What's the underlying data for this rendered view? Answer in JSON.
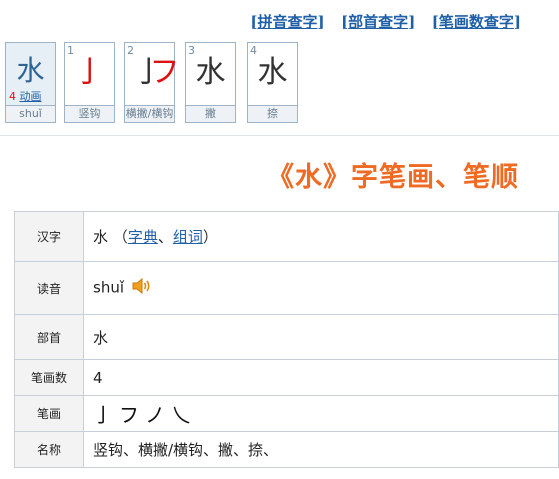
{
  "nav": {
    "bracket_open": "[",
    "bracket_close": "]",
    "links": [
      "拼音查字",
      "部首查字",
      "笔画数查字"
    ]
  },
  "cards": {
    "first": {
      "glyph": "水",
      "strokes": "4",
      "animate_label": "动画",
      "pinyin": "shuǐ"
    },
    "steps": [
      {
        "num": "1",
        "glyph_red": "亅",
        "glyph_black": "",
        "caption": "竖钩"
      },
      {
        "num": "2",
        "glyph_black": "亅",
        "glyph_red": "フ",
        "caption": "横撇/横钩"
      },
      {
        "num": "3",
        "glyph_black": "水",
        "glyph_red": "",
        "caption": "撇"
      },
      {
        "num": "4",
        "glyph_black": "水",
        "glyph_red": "",
        "caption": "捺"
      }
    ]
  },
  "title": "《水》字笔画、笔顺",
  "info": {
    "hanzi_label": "汉字",
    "hanzi_value": "水",
    "paren_open": "（",
    "link_zidian": "字典",
    "sep": "、",
    "link_zuci": "组词",
    "paren_close": "）",
    "reading_label": "读音",
    "reading_value": "shuǐ",
    "radical_label": "部首",
    "radical_value": "水",
    "stroke_count_label": "笔画数",
    "stroke_count_value": "4",
    "strokes_label": "笔画",
    "strokes_value": "亅フノ乀",
    "names_label": "名称",
    "names_value": "竖钩、横撇/横钩、撇、捺、"
  },
  "colors": {
    "link": "#1f5fa8",
    "title": "#ef6a22",
    "stroke_highlight": "#dd1111"
  },
  "icons": {
    "speaker": "speaker-icon"
  }
}
